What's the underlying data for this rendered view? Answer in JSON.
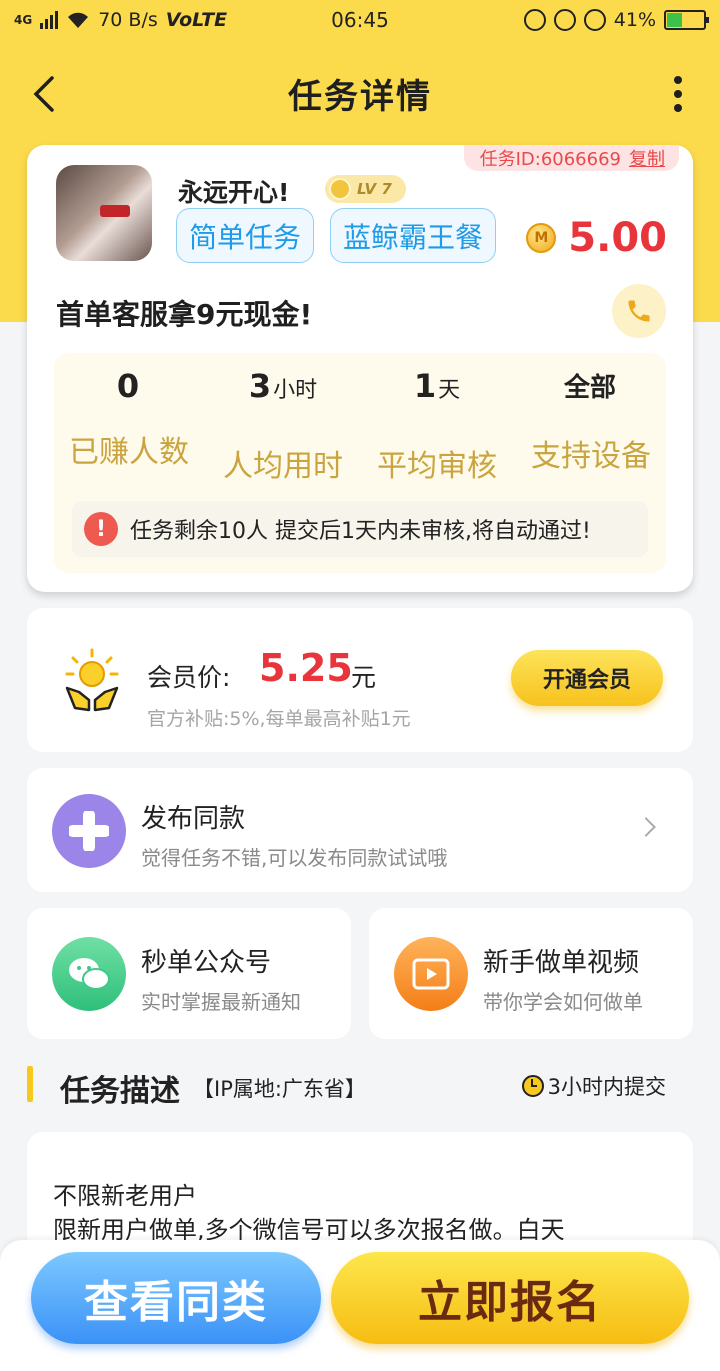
{
  "status_bar": {
    "network": "4G",
    "speed": "70 B/s",
    "volte": "VoLTE",
    "time": "06:45",
    "battery": "41%",
    "battery_level": 0.41,
    "icons": [
      "signal-icon",
      "wifi-icon",
      "data-saver-icon",
      "screen-lock-icon",
      "alarm-icon",
      "battery-icon"
    ]
  },
  "nav": {
    "title": "任务详情",
    "back_icon": "chevron-left-icon",
    "more_icon": "more-vertical-icon"
  },
  "task": {
    "id_label": "任务ID:6066669",
    "copy_label": "复制",
    "username": "永远开心!",
    "level": "LV 7",
    "tags": [
      "简单任务",
      "蓝鲸霸王餐"
    ],
    "coin_symbol": "M",
    "reward": "5.00",
    "title": "首单客服拿9元现金!",
    "stats": [
      {
        "value": "0",
        "unit": "",
        "label": "已赚人数"
      },
      {
        "value": "3",
        "unit": "小时",
        "label": "人均用时"
      },
      {
        "value": "1",
        "unit": "天",
        "label": "平均审核"
      },
      {
        "value": "全部",
        "unit": "",
        "label": "支持设备"
      }
    ],
    "notice": "任务剩余10人  提交后1天内未审核,将自动通过!"
  },
  "member": {
    "label": "会员价:",
    "price": "5.25",
    "unit": "元",
    "sub": "官方补贴:5%,每单最高补贴1元",
    "button": "开通会员"
  },
  "publish": {
    "title": "发布同款",
    "sub": "觉得任务不错,可以发布同款试试哦"
  },
  "cards": [
    {
      "title": "秒单公众号",
      "sub": "实时掌握最新通知",
      "icon": "wechat-icon"
    },
    {
      "title": "新手做单视频",
      "sub": "带你学会如何做单",
      "icon": "video-icon"
    }
  ],
  "description": {
    "title": "任务描述",
    "ip": "【IP属地:广东省】",
    "time_limit": "3小时内提交",
    "lines": [
      "不限新老用户",
      "限新用户做单,多个微信号可以多次报名做。白天"
    ]
  },
  "bottom": {
    "same_button": "查看同类",
    "join_button": "立即报名"
  },
  "colors": {
    "header_yellow": "#fbdb4c",
    "accent_red": "#e8343b",
    "tag_blue": "#1f9be8",
    "label_gold": "#c9a43f"
  }
}
